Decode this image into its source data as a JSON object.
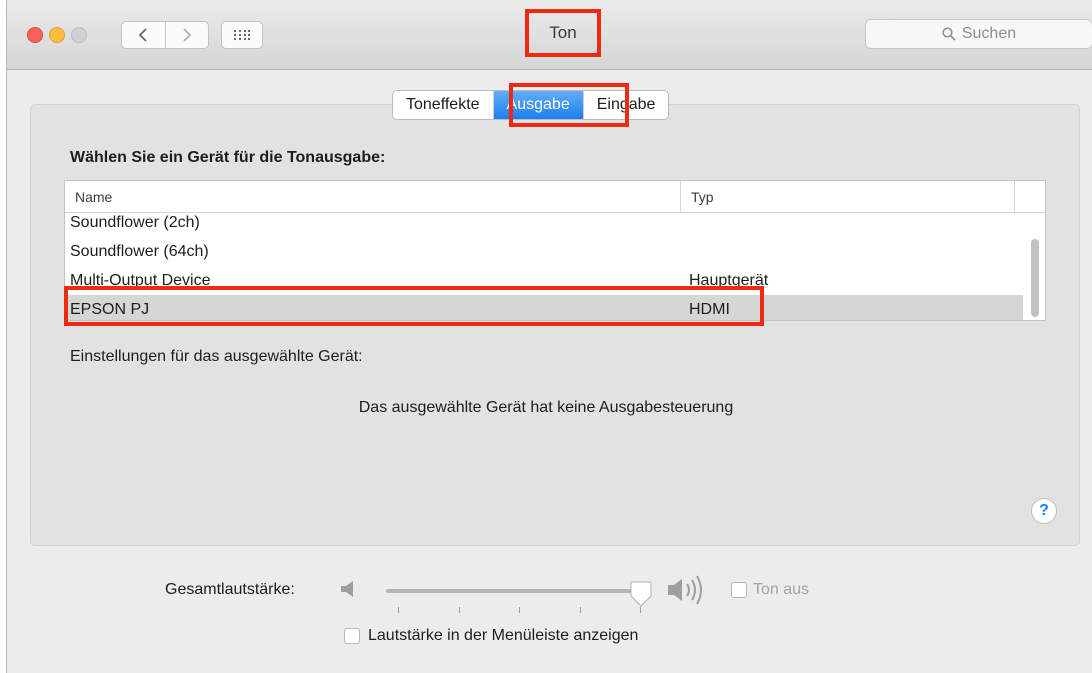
{
  "window": {
    "title": "Ton"
  },
  "search": {
    "placeholder": "Suchen"
  },
  "tabs": [
    {
      "label": "Toneffekte",
      "active": false
    },
    {
      "label": "Ausgabe",
      "active": true
    },
    {
      "label": "Eingabe",
      "active": false
    }
  ],
  "output": {
    "heading": "Wählen Sie ein Gerät für die Tonausgabe:",
    "columns": {
      "name": "Name",
      "type": "Typ"
    },
    "devices": [
      {
        "name": "Soundflower (2ch)",
        "type": ""
      },
      {
        "name": "Soundflower (64ch)",
        "type": ""
      },
      {
        "name": "Multi-Output Device",
        "type": "Hauptgerät"
      },
      {
        "name": "EPSON PJ",
        "type": "HDMI",
        "selected": true
      }
    ],
    "settings_label": "Einstellungen für das ausgewählte Gerät:",
    "no_control_message": "Das ausgewählte Gerät hat keine Ausgabesteuerung",
    "help": "?"
  },
  "volume": {
    "label": "Gesamtlautstärke:",
    "level_fraction": 0.96,
    "mute_label": "Ton aus",
    "mute_checked": false,
    "show_in_menubar_label": "Lautstärke in der Menüleiste anzeigen",
    "show_in_menubar_checked": false
  },
  "colors": {
    "highlight": "#ee2a12",
    "accent": "#1b7ff0",
    "selected_row": "#d6d6d6"
  },
  "icons": [
    "back-chevron-icon",
    "forward-chevron-icon",
    "grid-icon",
    "search-icon",
    "speaker-low-icon",
    "speaker-high-icon",
    "help-icon"
  ]
}
